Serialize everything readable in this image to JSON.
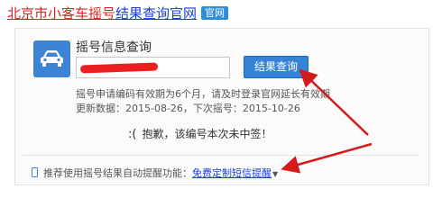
{
  "header": {
    "title_part1": "北京市小客车摇号",
    "title_part2": "结果查询官网",
    "badge": "官网"
  },
  "card": {
    "title": "摇号信息查询",
    "query_button": "结果查询",
    "validity_note": "摇号申请编码有效期为6个月，请及时登录官网延长有效期",
    "update_info": "更新数据：2015-08-26，下次摇号：2015-10-26",
    "result_face": ":(",
    "result_message": "抱歉，该编号本次未中签！",
    "reminder_label": "推荐使用摇号结果自动提醒功能：",
    "reminder_link": "免费定制短信提醒"
  },
  "colors": {
    "accent": "#3683d6",
    "title_red": "#e02020",
    "link_blue": "#1a3fd8",
    "annotation_red": "#d41a1a"
  },
  "icons": [
    "car-icon",
    "phone-icon",
    "caret-down-icon"
  ]
}
